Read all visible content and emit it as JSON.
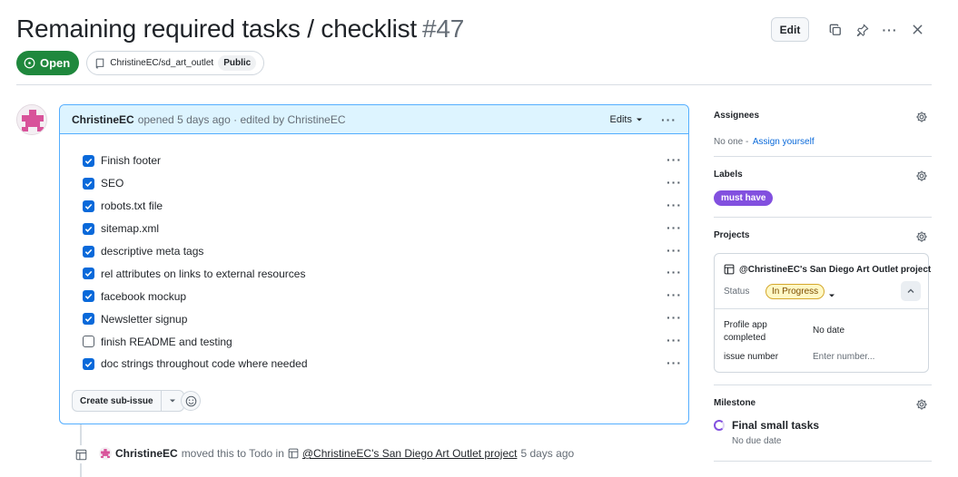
{
  "issue": {
    "title": "Remaining required tasks / checklist",
    "number": "#47",
    "state": "Open",
    "repo": "ChristineEC/sd_art_outlet",
    "visibility": "Public"
  },
  "header_actions": {
    "edit_label": "Edit"
  },
  "comment": {
    "author": "ChristineEC",
    "meta": "opened 5 days ago · edited by ChristineEC",
    "edits_label": "Edits",
    "tasks": [
      {
        "label": "Finish footer",
        "checked": true
      },
      {
        "label": "SEO",
        "checked": true
      },
      {
        "label": "robots.txt file",
        "checked": true
      },
      {
        "label": "sitemap.xml",
        "checked": true
      },
      {
        "label": "descriptive meta tags",
        "checked": true
      },
      {
        "label": "rel attributes on links to external resources",
        "checked": true
      },
      {
        "label": "facebook mockup",
        "checked": true
      },
      {
        "label": "Newsletter signup",
        "checked": true
      },
      {
        "label": "finish README and testing",
        "checked": false
      },
      {
        "label": "doc strings throughout code where needed",
        "checked": true
      }
    ],
    "create_sub_issue_label": "Create sub-issue"
  },
  "timeline": {
    "author": "ChristineEC",
    "action": "moved this to Todo in",
    "project": "@ChristineEC's San Diego Art Outlet project",
    "time": "5 days ago"
  },
  "sidebar": {
    "assignees": {
      "heading": "Assignees",
      "none_text": "No one -",
      "assign_link": "Assign yourself"
    },
    "labels": {
      "heading": "Labels",
      "items": [
        {
          "name": "must have",
          "color": "#8250df"
        }
      ]
    },
    "projects": {
      "heading": "Projects",
      "project_name": "@ChristineEC's San Diego Art Outlet project",
      "status_label": "Status",
      "status_value": "In Progress",
      "fields": [
        {
          "label": "Profile app completed",
          "value": "No date"
        },
        {
          "label": "issue number",
          "placeholder": "Enter number..."
        }
      ]
    },
    "milestone": {
      "heading": "Milestone",
      "name": "Final small tasks",
      "due": "No due date"
    }
  },
  "colors": {
    "open_green": "#1f883d",
    "accent_blue": "#0969da",
    "label_purple": "#8250df",
    "comment_header_bg": "#ddf4ff",
    "in_progress_bg": "#fff8c5"
  }
}
